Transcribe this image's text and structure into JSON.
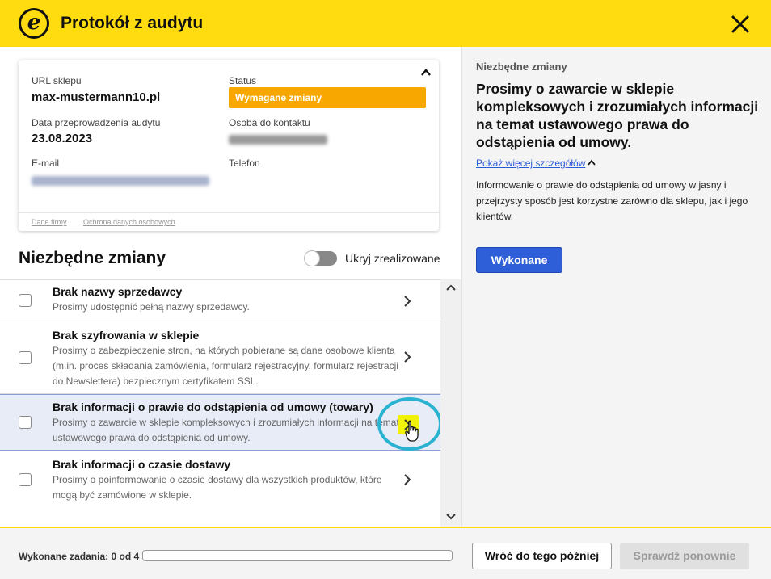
{
  "header": {
    "logo_letter": "e",
    "title": "Protokół z audytu",
    "brand_color": "#ffdc0f"
  },
  "shop_card": {
    "url_label": "URL sklepu",
    "url_value": "max-mustermann10.pl",
    "status_label": "Status",
    "status_value": "Wymagane zmiany",
    "status_color": "#f7a700",
    "date_label": "Data przeprowadzenia audytu",
    "date_value": "23.08.2023",
    "contact_label": "Osoba do kontaktu",
    "email_label": "E-mail",
    "phone_label": "Telefon",
    "footer_links": [
      "Dane firmy",
      "Ochrona danych osobowych"
    ]
  },
  "changes": {
    "title": "Niezbędne zmiany",
    "toggle_label": "Ukryj zrealizowane",
    "items": [
      {
        "title": "Brak nazwy sprzedawcy",
        "desc": "Prosimy udostępnić pełną nazwy sprzedawcy."
      },
      {
        "title": "Brak szyfrowania w sklepie",
        "desc": "Prosimy o zabezpieczenie stron, na których pobierane są dane osobowe klienta (m.in. proces składania zamówienia, formularz rejestracyjny, formularz rejestracji do Newslettera) bezpiecznym certyfikatem SSL."
      },
      {
        "title": "Brak informacji o prawie do odstąpienia od umowy (towary)",
        "desc": "Prosimy o zawarcie w sklepie kompleksowych i zrozumiałych informacji na temat ustawowego prawa do odstąpienia od umowy.",
        "selected": true
      },
      {
        "title": "Brak informacji o czasie dostawy",
        "desc": "Prosimy o poinformowanie o czasie dostawy dla wszystkich produktów, które mogą być zamówione w sklepie."
      }
    ]
  },
  "detail": {
    "label": "Niezbędne zmiany",
    "heading": "Prosimy o zawarcie w sklepie kompleksowych i zrozumiałych informacji na temat ustawowego prawa do odstąpienia od umowy.",
    "toggle_link": "Pokaż więcej szczegółów",
    "text": "Informowanie o prawie do odstąpienia od umowy w jasny i przejrzysty sposób jest korzystne zarówno dla sklepu, jak i jego klientów.",
    "done_button": "Wykonane",
    "accent_color": "#2f5fd8"
  },
  "footer": {
    "progress_label": "Wykonane zadania: 0 od 4",
    "progress_done": 0,
    "progress_total": 4,
    "later_button": "Wróć do tego później",
    "check_button": "Sprawdź ponownie"
  }
}
